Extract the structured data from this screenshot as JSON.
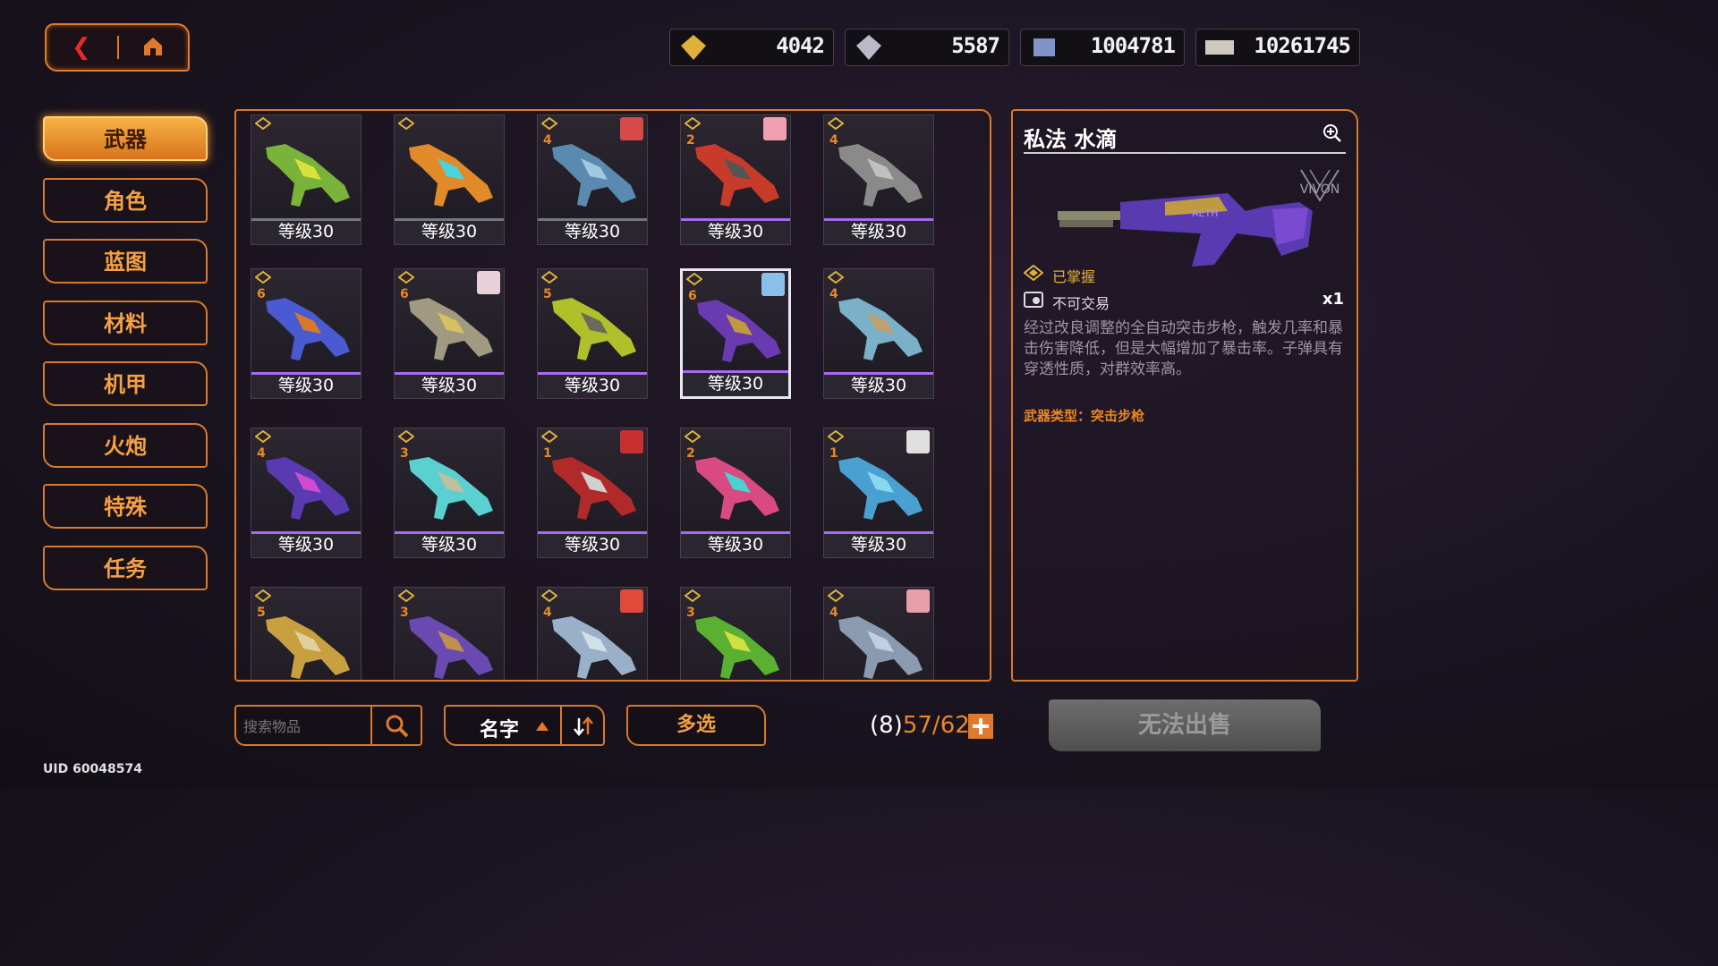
{
  "currencies": [
    {
      "icon": "gold-gem-icon",
      "value": "4042",
      "color": "#e0b13a"
    },
    {
      "icon": "silver-gem-icon",
      "value": "5587",
      "color": "#b9b9c9"
    },
    {
      "icon": "data-chip-icon",
      "value": "1004781",
      "color": "#7f95c8"
    },
    {
      "icon": "ticket-icon",
      "value": "10261745",
      "color": "#cfc9bd"
    }
  ],
  "tabs": [
    "武器",
    "角色",
    "蓝图",
    "材料",
    "机甲",
    "火炮",
    "特殊",
    "任务"
  ],
  "active_tab_index": 0,
  "grid": {
    "level_label": "等级30",
    "items": [
      {
        "rank": "",
        "portrait": "",
        "gun": "#7ab33a",
        "accent": "#d8e23c",
        "plain": true
      },
      {
        "rank": "",
        "portrait": "",
        "gun": "#e08a2a",
        "accent": "#4ad3d8",
        "plain": true
      },
      {
        "rank": "4",
        "portrait": "#d84a4a",
        "gun": "#5a8ab0",
        "accent": "#a0c8e0",
        "plain": true
      },
      {
        "rank": "2",
        "portrait": "#f0a0b0",
        "gun": "#c83a2a",
        "accent": "#555",
        "plain": false
      },
      {
        "rank": "4",
        "portrait": "",
        "gun": "#8a8a8a",
        "accent": "#c0c0c0",
        "plain": false
      },
      {
        "rank": "6",
        "portrait": "",
        "gun": "#4a5ad0",
        "accent": "#d87a2a",
        "plain": false
      },
      {
        "rank": "6",
        "portrait": "#e8d0d8",
        "gun": "#a09a80",
        "accent": "#d8c060",
        "plain": false
      },
      {
        "rank": "5",
        "portrait": "",
        "gun": "#b0c02a",
        "accent": "#6a6a5a",
        "plain": false
      },
      {
        "rank": "6",
        "portrait": "#8ac0e8",
        "gun": "#6a3ab0",
        "accent": "#c09a40",
        "plain": false
      },
      {
        "rank": "4",
        "portrait": "",
        "gun": "#7ab0c8",
        "accent": "#c0a070",
        "plain": false
      },
      {
        "rank": "4",
        "portrait": "",
        "gun": "#5a3ab0",
        "accent": "#d04ad0",
        "plain": false
      },
      {
        "rank": "3",
        "portrait": "",
        "gun": "#5ad0d0",
        "accent": "#c0c0a0",
        "plain": false
      },
      {
        "rank": "1",
        "portrait": "#c83030",
        "gun": "#b02a2a",
        "accent": "#d0d0d0",
        "plain": false
      },
      {
        "rank": "2",
        "portrait": "",
        "gun": "#d84a80",
        "accent": "#4ad0d0",
        "plain": false
      },
      {
        "rank": "1",
        "portrait": "#e0e0e0",
        "gun": "#4aa0d0",
        "accent": "#8ad8f0",
        "plain": false
      },
      {
        "rank": "5",
        "portrait": "",
        "gun": "#c8a040",
        "accent": "#e0d0a0",
        "plain": false
      },
      {
        "rank": "3",
        "portrait": "",
        "gun": "#6a4ab0",
        "accent": "#c09050",
        "plain": false
      },
      {
        "rank": "4",
        "portrait": "#e04a3a",
        "gun": "#9ab0c8",
        "accent": "#d0e0e8",
        "plain": false
      },
      {
        "rank": "3",
        "portrait": "",
        "gun": "#5ab030",
        "accent": "#d0e040",
        "plain": false
      },
      {
        "rank": "4",
        "portrait": "#e8a0a8",
        "gun": "#8a9ab0",
        "accent": "#c0d0e0",
        "plain": false
      }
    ],
    "selected_index": 8
  },
  "detail": {
    "name": "私法 水滴",
    "brand": "VIVON",
    "mastered": "已掌握",
    "tradable": "不可交易",
    "quantity": "x1",
    "description": "经过改良调整的全自动突击步枪，触发几率和暴击伤害降低，但是大幅增加了暴击率。子弹具有穿透性质，对群效率高。",
    "weapon_type": "武器类型：突击步枪"
  },
  "bottom": {
    "search_placeholder": "搜索物品",
    "sort_label": "名字",
    "multi_select": "多选",
    "count_prefix": "(8)",
    "count_value": "57/62",
    "sell_button": "无法出售"
  },
  "uid": "UID 60048574",
  "colors": {
    "accent": "#d97a2a",
    "rarity_purple": "#a86af0"
  }
}
